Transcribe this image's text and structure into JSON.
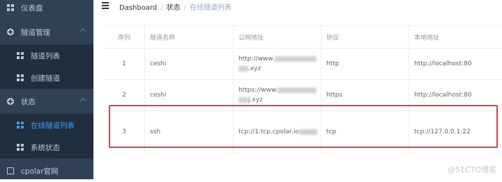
{
  "sidebar": {
    "items": [
      {
        "label": "仪表盘",
        "icon": "dashboard-icon",
        "type": "top"
      },
      {
        "label": "隧道管理",
        "icon": "plus-circle-icon",
        "type": "top"
      },
      {
        "label": "隧道列表",
        "icon": "grid-icon",
        "type": "sub"
      },
      {
        "label": "创建隧道",
        "icon": "grid-icon",
        "type": "sub"
      },
      {
        "label": "状态",
        "icon": "plus-circle-icon",
        "type": "top"
      },
      {
        "label": "在线隧道列表",
        "icon": "grid-icon",
        "type": "sub",
        "active": true
      },
      {
        "label": "系统状态",
        "icon": "grid-icon",
        "type": "sub"
      },
      {
        "label": "cpolar官网",
        "icon": "external-link-icon",
        "type": "top"
      }
    ]
  },
  "breadcrumb": {
    "root": "Dashboard",
    "sep": "/",
    "parent": "状态",
    "current": "在线隧道列表"
  },
  "table": {
    "headers": [
      "序列",
      "隧道名称",
      "公网地址",
      "协议",
      "本地地址"
    ],
    "rows": [
      {
        "index": "1",
        "name": "ceshi",
        "url_a": "http://www.",
        "url_b": ".xyz",
        "protocol": "http",
        "local": "http://localhost:80"
      },
      {
        "index": "2",
        "name": "ceshi",
        "url_a": "https://www.",
        "url_b": "j.xyz",
        "protocol": "https",
        "local": "http://localhost:80"
      },
      {
        "index": "3",
        "name": "ssh",
        "url_a": "tcp://1.tcp.cpolar.io",
        "url_b": "",
        "protocol": "tcp",
        "local": "tcp://127.0.0.1:22"
      }
    ]
  },
  "watermark": "@51CTO博客",
  "colors": {
    "sidebar_bg": "#304156",
    "submenu_bg": "#1f2d3d",
    "active": "#409eff",
    "highlight": "#e53935"
  }
}
